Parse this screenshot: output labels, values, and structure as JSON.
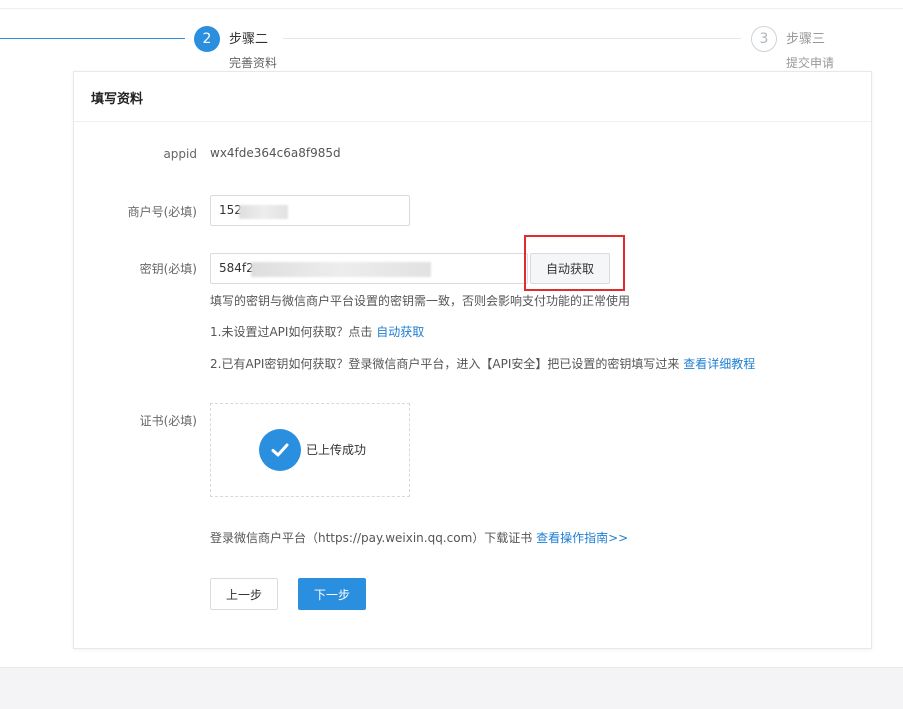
{
  "steps": {
    "step2": {
      "number": "2",
      "title": "步骤二",
      "subtitle": "完善资料"
    },
    "step3": {
      "number": "3",
      "title": "步骤三",
      "subtitle": "提交申请"
    }
  },
  "card": {
    "title": "填写资料"
  },
  "form": {
    "appid": {
      "label": "appid",
      "value": "wx4fde364c6a8f985d"
    },
    "merchant_id": {
      "label": "商户号(必填)",
      "visible_prefix": "152"
    },
    "secret": {
      "label": "密钥(必填)",
      "visible_prefix": "584f2",
      "auto_button_label": "自动获取",
      "help_text": "填写的密钥与微信商户平台设置的密钥需一致，否则会影响支付功能的正常使用",
      "tip1_prefix": "1.未设置过API如何获取？点击",
      "tip1_link": "自动获取",
      "tip2_prefix": "2.已有API密钥如何获取？登录微信商户平台，进入【API安全】把已设置的密钥填写过来",
      "tip2_link": "查看详细教程"
    },
    "certificate": {
      "label": "证书(必填)",
      "status": "已上传成功"
    },
    "footer": {
      "prefix": "登录微信商户平台（https://pay.weixin.qq.com）下载证书",
      "link": "查看操作指南>>"
    },
    "buttons": {
      "prev": "上一步",
      "next": "下一步"
    }
  },
  "colors": {
    "primary": "#2b8fe0",
    "link": "#1f7fd1",
    "highlight": "#e02c2c"
  }
}
